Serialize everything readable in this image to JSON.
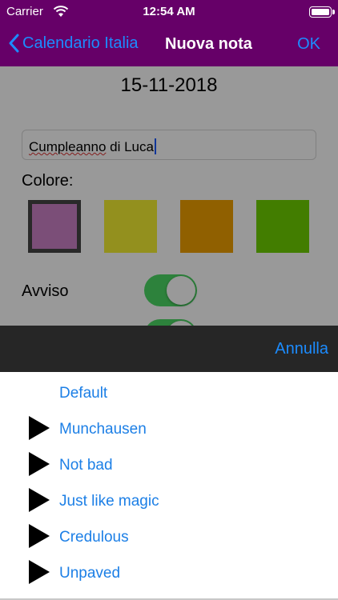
{
  "status_bar": {
    "carrier": "Carrier",
    "time": "12:54 AM",
    "wifi_icon": "wifi-icon",
    "battery_icon": "battery-icon"
  },
  "nav": {
    "back_label": "Calendario Italia",
    "title": "Nuova nota",
    "ok_label": "OK"
  },
  "form": {
    "date": "15-11-2018",
    "note_word1": "Cumpleanno",
    "note_rest": " di Luca",
    "colore_label": "Colore:",
    "colors": [
      "#ce82c8",
      "#f5f032",
      "#f0a000",
      "#6ed000"
    ],
    "selected_color_index": 0,
    "avviso_label": "Avviso",
    "avviso_on": true
  },
  "sheet": {
    "cancel_label": "Annulla",
    "items": [
      {
        "label": "Default",
        "icon": "none"
      },
      {
        "label": "Munchausen",
        "icon": "play-icon"
      },
      {
        "label": "Not bad",
        "icon": "play-icon"
      },
      {
        "label": "Just like magic",
        "icon": "play-icon"
      },
      {
        "label": "Credulous",
        "icon": "play-icon"
      },
      {
        "label": "Unpaved",
        "icon": "play-icon"
      }
    ]
  },
  "colors": {
    "nav_background": "#660068",
    "link_blue": "#1c8cff",
    "toggle_green": "#4cd964"
  }
}
